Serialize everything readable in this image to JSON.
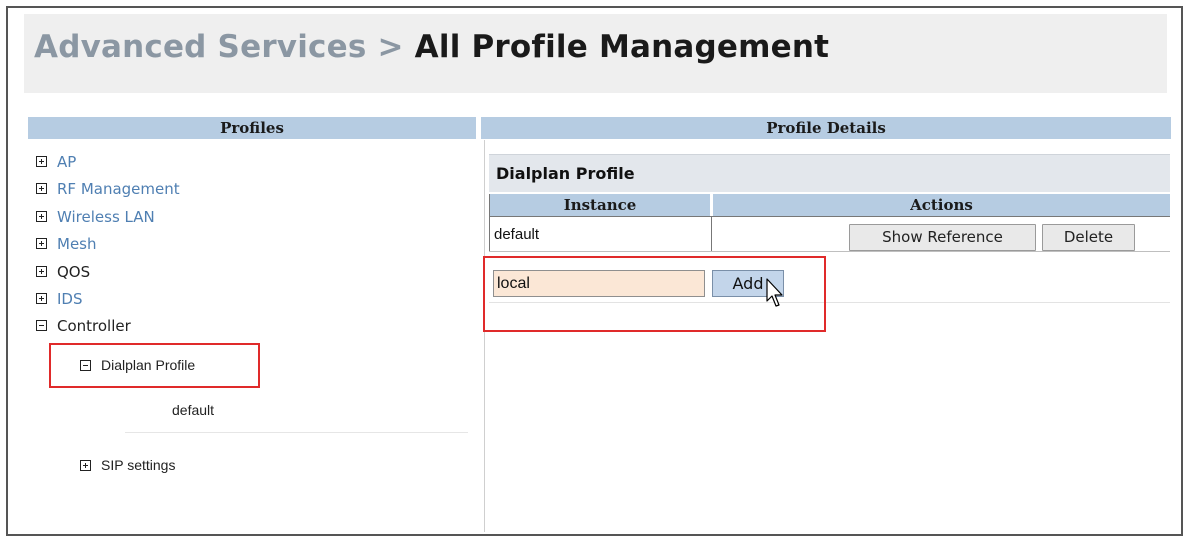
{
  "header": {
    "crumb": "Advanced Services",
    "separator": " > ",
    "current": "All Profile Management"
  },
  "columns": {
    "profiles": "Profiles",
    "profile_details": "Profile Details"
  },
  "tree": {
    "items": [
      {
        "label": "AP",
        "state": "collapsed",
        "style": "link"
      },
      {
        "label": "RF Management",
        "state": "collapsed",
        "style": "link"
      },
      {
        "label": "Wireless LAN",
        "state": "collapsed",
        "style": "link"
      },
      {
        "label": "Mesh",
        "state": "collapsed",
        "style": "link"
      },
      {
        "label": "QOS",
        "state": "collapsed",
        "style": "plain"
      },
      {
        "label": "IDS",
        "state": "collapsed",
        "style": "link"
      },
      {
        "label": "Controller",
        "state": "expanded",
        "style": "plain"
      }
    ],
    "dialplan": {
      "label": "Dialplan Profile",
      "state": "expanded"
    },
    "dialplan_instance": "default",
    "sip": {
      "label": "SIP settings",
      "state": "collapsed"
    }
  },
  "details": {
    "title": "Dialplan Profile",
    "headers": {
      "instance": "Instance",
      "actions": "Actions"
    },
    "rows": [
      {
        "instance": "default",
        "show_reference": "Show Reference",
        "delete": "Delete"
      }
    ],
    "new_instance_value": "local",
    "add_label": "Add"
  },
  "colors": {
    "highlight_border": "#e02a2a",
    "column_header_bg": "#b6cce2",
    "link": "#4f7fb2",
    "input_bg": "#fbe7d6",
    "add_button_bg": "#c3d5ea"
  }
}
